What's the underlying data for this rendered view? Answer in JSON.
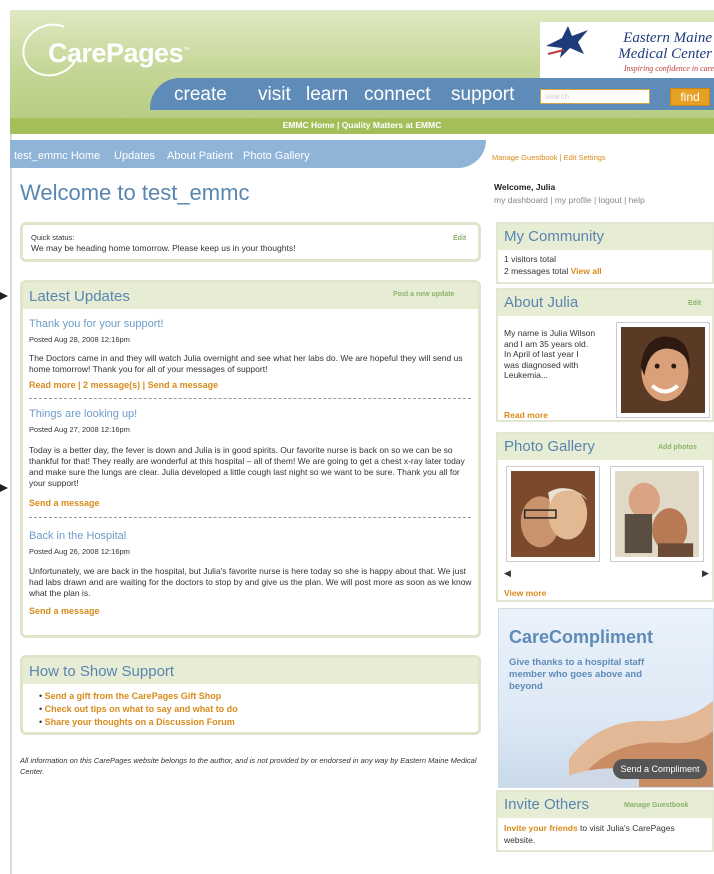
{
  "header": {
    "logo_text": "CarePages",
    "logo_tm": "™",
    "emmc_name_line1": "Eastern Maine",
    "emmc_name_line2": "Medical Center",
    "emmc_tagline": "Inspiring confidence in care",
    "nav": [
      "create",
      "visit",
      "learn",
      "connect",
      "support"
    ],
    "search_placeholder": "search",
    "find_label": "find",
    "green_bar": "EMMC Home | Quality Matters at EMMC"
  },
  "subnav": {
    "items": [
      "test_emmc Home",
      "Updates",
      "About Patient",
      "Photo Gallery"
    ],
    "right_links": "Manage Guestbook | Edit Settings"
  },
  "page_title": "Welcome to test_emmc",
  "quick_status": {
    "label": "Quick status:",
    "text": "We may be heading home tomorrow. Please keep us in your thoughts!",
    "edit": "Edit"
  },
  "latest_updates": {
    "title": "Latest Updates",
    "post_link": "Post a new update",
    "updates": [
      {
        "title": "Thank you for your support!",
        "date": "Posted Aug 28, 2008 12:16pm",
        "body": "The Doctors came in and they will watch Julia overnight and see what her labs do. We are hopeful they will send us home tomorrow! Thank you for all of your messages of support!",
        "links": "Read more | 2 message(s) | Send a message"
      },
      {
        "title": "Things are looking up!",
        "date": "Posted Aug 27, 2008 12:16pm",
        "body": "Today is a better day, the fever is down and Julia is in good spirits. Our favorite nurse is back on so we can be so thankful for that! They really are wonderful at this hospital – all of them! We are going to get a chest x-ray later today and make sure the lungs are clear. Julia developed a little cough last night so we want to be sure. Thank you all for your support!",
        "links": "Send a message"
      },
      {
        "title": "Back in the Hospital",
        "date": "Posted Aug 26, 2008 12:16pm",
        "body": "Unfortunately, we are back in the hospital, but Julia's favorite nurse is here today so she is happy about that. We just had labs drawn and are waiting for the doctors to stop by and give us the plan. We will post more as soon as we know what the plan is.",
        "links": "Send a message"
      }
    ]
  },
  "support": {
    "title": "How to Show Support",
    "items": [
      "Send a gift from the CarePages Gift Shop",
      "Check out tips on what to say and what to do",
      "Share your thoughts on a Discussion Forum"
    ]
  },
  "disclaimer": "All information on this CarePages website belongs to the author, and is not provided by or endorsed in any way by Eastern Maine Medical Center.",
  "sidebar": {
    "welcome": "Welcome, Julia",
    "user_links": "my dashboard | my profile | logout | help",
    "community": {
      "title": "My Community",
      "visitors": "1 visitors total",
      "messages_prefix": "2 messages total",
      "view_all": "View all"
    },
    "about": {
      "title": "About Julia",
      "edit": "Edit",
      "text": "My name is Julia Wilson and I am 35 years old. In April of last year I was diagnosed with Leukemia...",
      "read_more": "Read more"
    },
    "gallery": {
      "title": "Photo Gallery",
      "add": "Add photos",
      "view_more": "View more"
    },
    "compliment": {
      "title": "CareCompliment",
      "text": "Give thanks to a hospital staff member who goes above and beyond",
      "button": "Send a Compliment"
    },
    "invite": {
      "title": "Invite Others",
      "manage": "Manage Guestbook",
      "link": "Invite your friends",
      "text": " to visit Julia's CarePages website."
    }
  },
  "colors": {
    "header_green": "#c5d797",
    "nav_blue": "#5f8bb8",
    "accent_orange": "#d88b1c",
    "title_blue": "#5886b0"
  }
}
